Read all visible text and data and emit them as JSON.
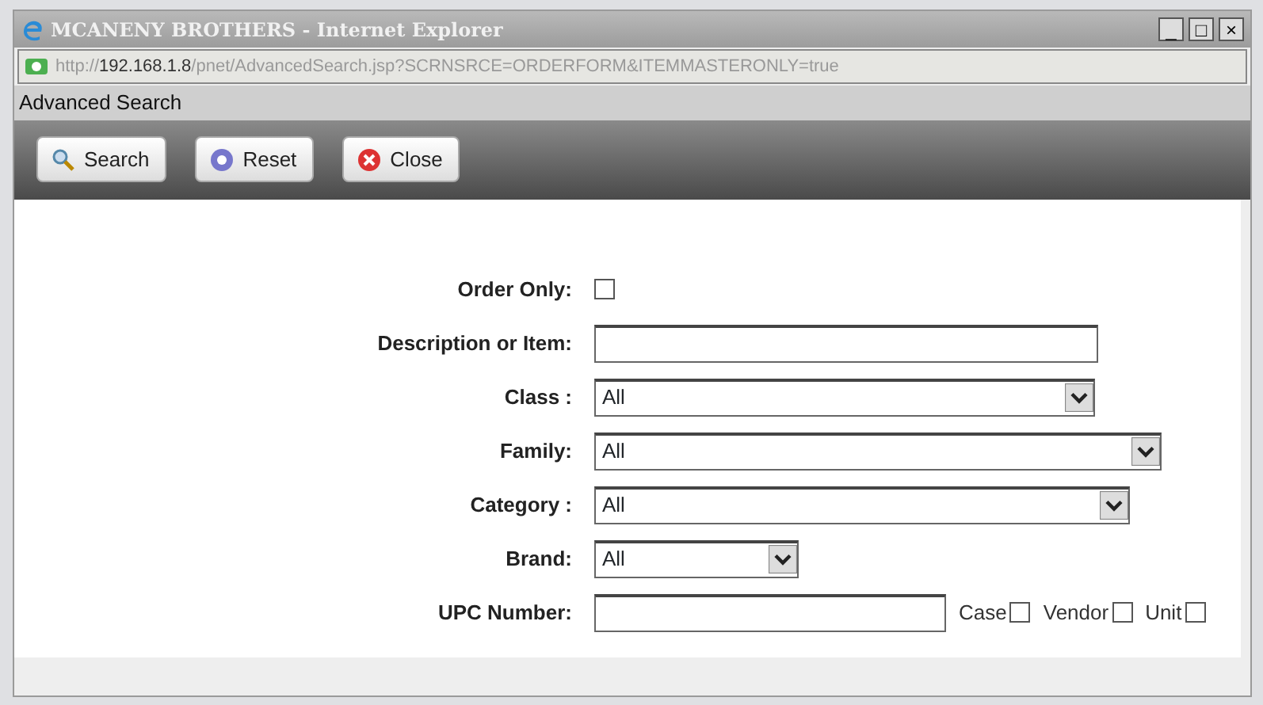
{
  "window": {
    "title": "MCANENY BROTHERS - Internet Explorer",
    "controls": [
      "_",
      "□",
      "×"
    ]
  },
  "address": {
    "prefix": "http://",
    "host": "192.168.1.8",
    "path": "/pnet/AdvancedSearch.jsp?SCRNSRCE=ORDERFORM&ITEMMASTERONLY=true"
  },
  "page_title": "Advanced Search",
  "toolbar": [
    {
      "label": "Search",
      "kind": "search"
    },
    {
      "label": "Reset",
      "kind": "reset"
    },
    {
      "label": "Close",
      "kind": "close"
    }
  ],
  "fields": [
    {
      "label": "Order Only:",
      "kind": "checkbox",
      "checked": false
    },
    {
      "label": "Description or Item:",
      "kind": "text"
    },
    {
      "label": "Class :",
      "kind": "select",
      "value": "All"
    },
    {
      "label": "Family:",
      "kind": "select",
      "value": "All"
    },
    {
      "label": "Category :",
      "kind": "select",
      "value": "All"
    },
    {
      "label": "Brand:",
      "kind": "select",
      "value": "All"
    },
    {
      "label": "UPC Number:",
      "kind": "text",
      "options": [
        {
          "label": "Case",
          "checked": false
        },
        {
          "label": "Vendor",
          "checked": false
        },
        {
          "label": "Unit",
          "checked": false
        }
      ]
    }
  ]
}
